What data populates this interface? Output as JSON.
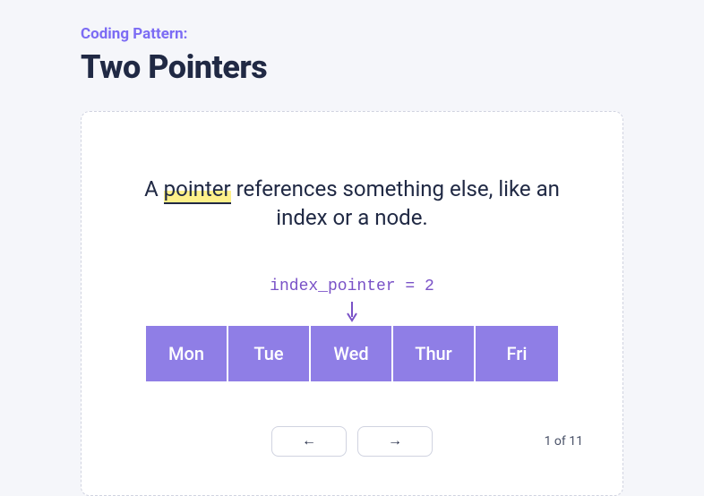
{
  "kicker": "Coding Pattern:",
  "title": "Two Pointers",
  "description": {
    "prefix": "A ",
    "highlighted": "pointer",
    "suffix": " references something else, like an index or a node."
  },
  "code": "index_pointer = 2",
  "days": [
    "Mon",
    "Tue",
    "Wed",
    "Thur",
    "Fri"
  ],
  "nav": {
    "prev_glyph": "←",
    "next_glyph": "→"
  },
  "pager": "1 of 11",
  "arrow_color": "#7a52c7"
}
